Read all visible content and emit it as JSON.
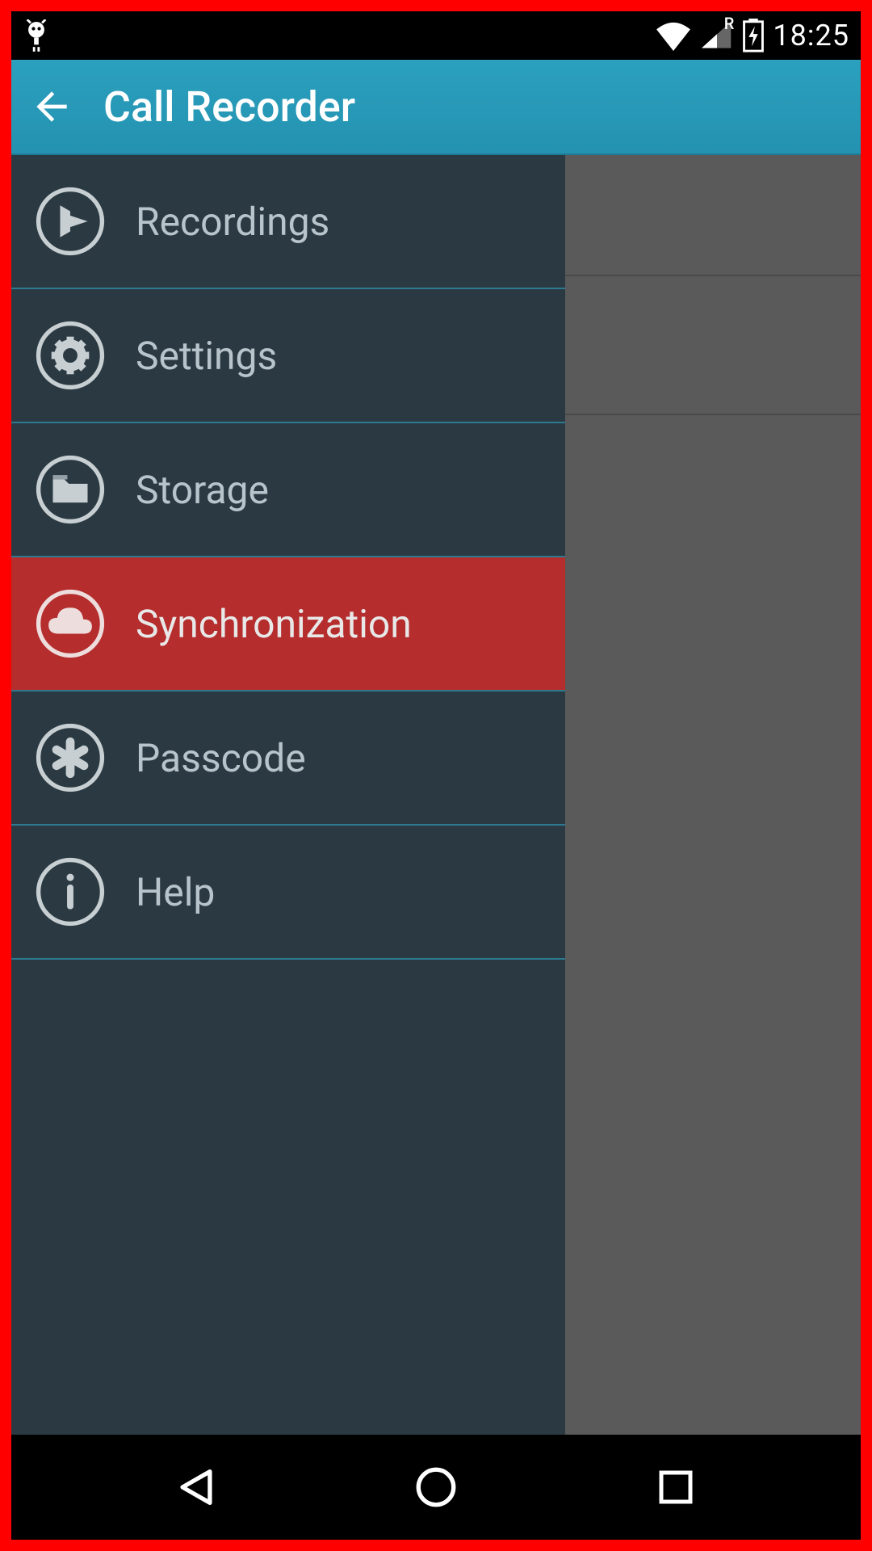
{
  "status": {
    "time": "18:25",
    "roaming_label": "R"
  },
  "header": {
    "title": "Call Recorder"
  },
  "menu": {
    "items": [
      {
        "label": "Recordings",
        "icon": "play",
        "selected": false
      },
      {
        "label": "Settings",
        "icon": "gear",
        "selected": false
      },
      {
        "label": "Storage",
        "icon": "folder",
        "selected": false
      },
      {
        "label": "Synchronization",
        "icon": "cloud",
        "selected": true
      },
      {
        "label": "Passcode",
        "icon": "asterisk",
        "selected": false
      },
      {
        "label": "Help",
        "icon": "info",
        "selected": false
      }
    ]
  },
  "colors": {
    "frame": "#ff0000",
    "actionbar": "#2ba0bf",
    "sidebar": "#2b3a42",
    "selected": "#b52d2d"
  }
}
